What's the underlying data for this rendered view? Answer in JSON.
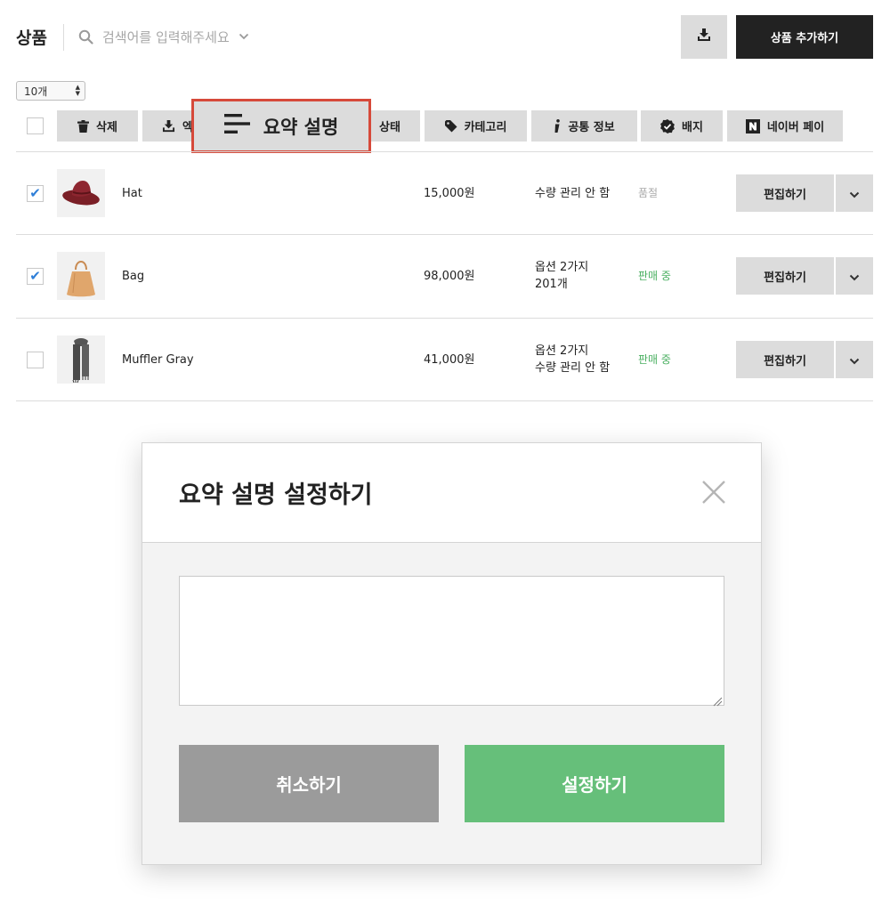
{
  "header": {
    "title": "상품",
    "search_placeholder": "검색어를 입력해주세요",
    "add_button": "상품 추가하기"
  },
  "per_page": {
    "selected": "10개"
  },
  "toolbar": {
    "delete": "삭제",
    "export": "엑",
    "summary": "요약 설명",
    "status": "상태",
    "category": "카테고리",
    "common_info": "공통 정보",
    "badge": "배지",
    "naver_pay": "네이버 페이"
  },
  "products": [
    {
      "name": "Hat",
      "price": "15,000원",
      "stock_line1": "수량 관리 안 함",
      "stock_line2": "",
      "state": "품절",
      "checked": true,
      "edit": "편집하기"
    },
    {
      "name": "Bag",
      "price": "98,000원",
      "stock_line1": "옵션 2가지",
      "stock_line2": "201개",
      "state": "판매 중",
      "checked": true,
      "edit": "편집하기"
    },
    {
      "name": "Muffler Gray",
      "price": "41,000원",
      "stock_line1": "옵션 2가지",
      "stock_line2": "수량 관리 안 함",
      "state": "판매 중",
      "checked": false,
      "edit": "편집하기"
    }
  ],
  "modal": {
    "title": "요약 설명 설정하기",
    "textarea_value": "",
    "cancel": "취소하기",
    "confirm": "설정하기"
  },
  "colors": {
    "accent_green": "#66bf7a",
    "status_selling": "#4bb062",
    "status_soldout": "#a8a8a8",
    "highlight_border": "#d6493a",
    "checkmark": "#2f7fd8"
  },
  "icons": [
    "search-icon",
    "chevron-down-icon",
    "download-icon",
    "trash-icon",
    "menu-lines-icon",
    "tag-icon",
    "info-icon",
    "verified-badge-icon",
    "naver-n-icon",
    "close-icon"
  ]
}
